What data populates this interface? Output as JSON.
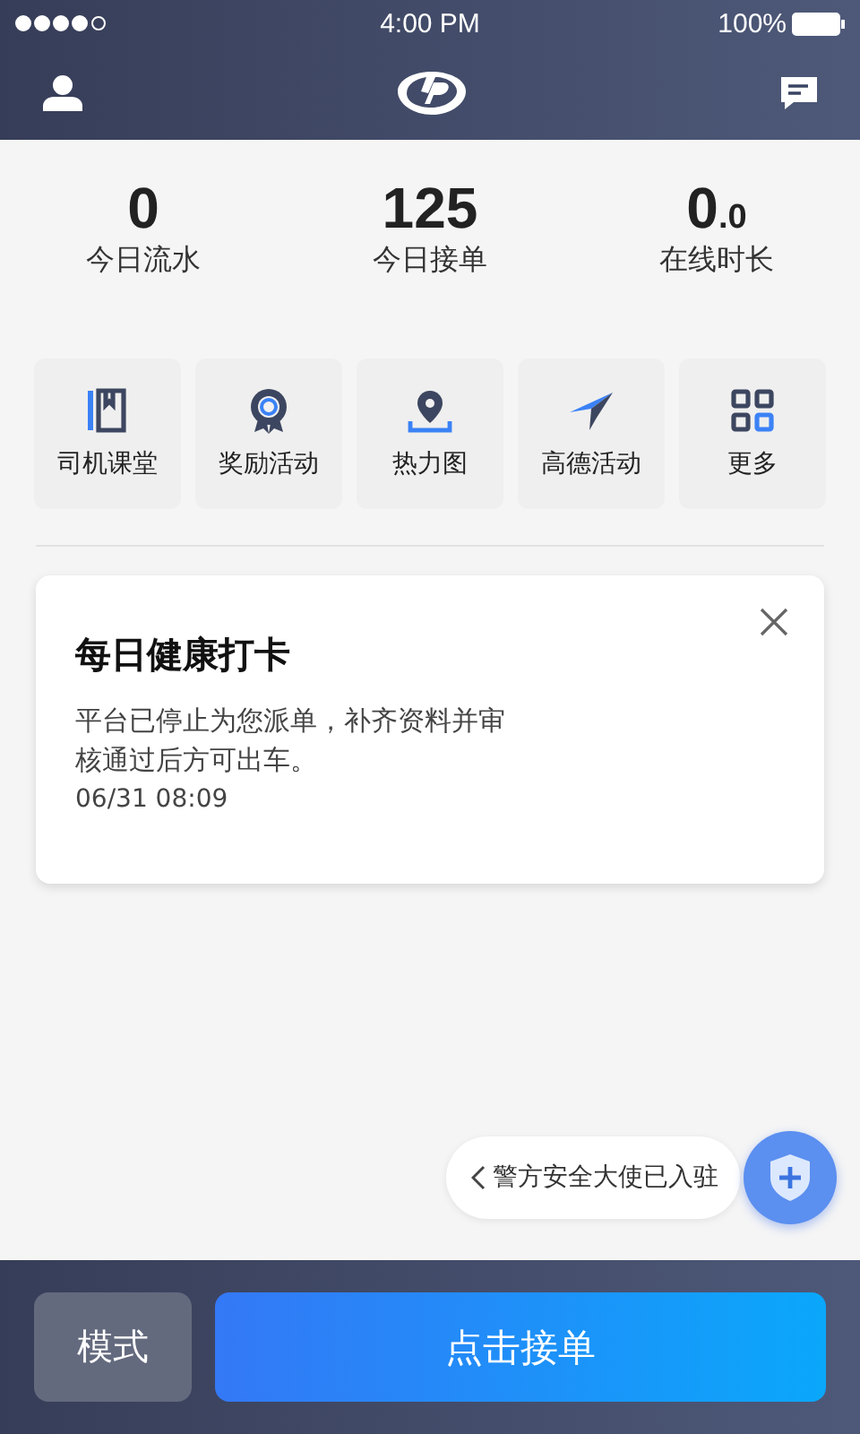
{
  "status_bar": {
    "time": "4:00 PM",
    "battery": "100%"
  },
  "stats": [
    {
      "value": "0",
      "label": "今日流水"
    },
    {
      "value": "125",
      "label": "今日接单"
    },
    {
      "value": "0",
      "fraction": ".0",
      "label": "在线时长"
    }
  ],
  "shortcuts": [
    {
      "kind": "book",
      "label": "司机课堂"
    },
    {
      "kind": "medal",
      "label": "奖励活动"
    },
    {
      "kind": "pin",
      "label": "热力图"
    },
    {
      "kind": "plane",
      "label": "高德活动"
    },
    {
      "kind": "grid",
      "label": "更多"
    }
  ],
  "notice": {
    "title": "每日健康打卡",
    "body": "平台已停止为您派单，补齐资料并审核通过后方可出车。",
    "time": "06/31 08:09"
  },
  "float_tip": {
    "text": "警方安全大使已入驻"
  },
  "bottom": {
    "mode_button": "模式",
    "accept_button": "点击接单"
  }
}
